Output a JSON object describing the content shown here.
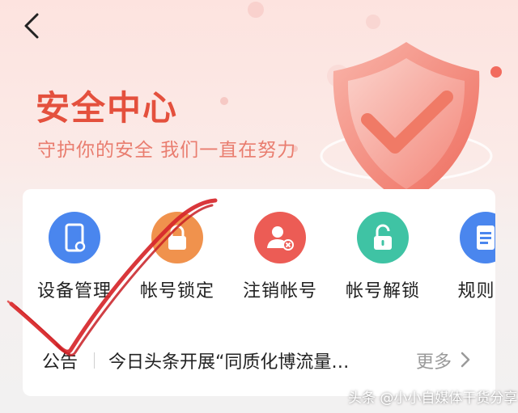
{
  "header": {
    "title": "安全中心",
    "subtitle": "守护你的安全 我们一直在努力"
  },
  "tools": [
    {
      "label": "设备管理",
      "icon": "device-icon",
      "color": "#4a86ee"
    },
    {
      "label": "帐号锁定",
      "icon": "lock-icon",
      "color": "#f0924d"
    },
    {
      "label": "注销帐号",
      "icon": "user-remove-icon",
      "color": "#ec5c55"
    },
    {
      "label": "帐号解锁",
      "icon": "unlock-icon",
      "color": "#3fc3a4"
    },
    {
      "label": "规则百",
      "icon": "document-icon",
      "color": "#4a86ee"
    }
  ],
  "notice": {
    "label": "公告",
    "text": "今日头条开展“同质化博流量…",
    "more_label": "更多"
  },
  "watermark": "头条 @小小自媒体干货分享",
  "colors": {
    "brand": "#e4503d",
    "subtitle": "#e97d6f",
    "check_stroke": "#d6262a"
  }
}
